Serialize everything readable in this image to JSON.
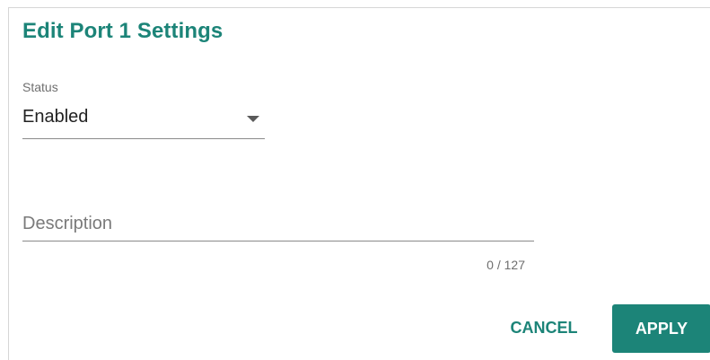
{
  "dialog": {
    "title": "Edit Port 1 Settings"
  },
  "status": {
    "label": "Status",
    "value": "Enabled",
    "icon": "dropdown-arrow-icon"
  },
  "description": {
    "placeholder": "Description",
    "value": "",
    "counter": "0 / 127"
  },
  "actions": {
    "cancel_label": "CANCEL",
    "apply_label": "APPLY"
  },
  "colors": {
    "accent": "#1c8478",
    "text": "#222222",
    "muted": "#6f6f6f"
  }
}
